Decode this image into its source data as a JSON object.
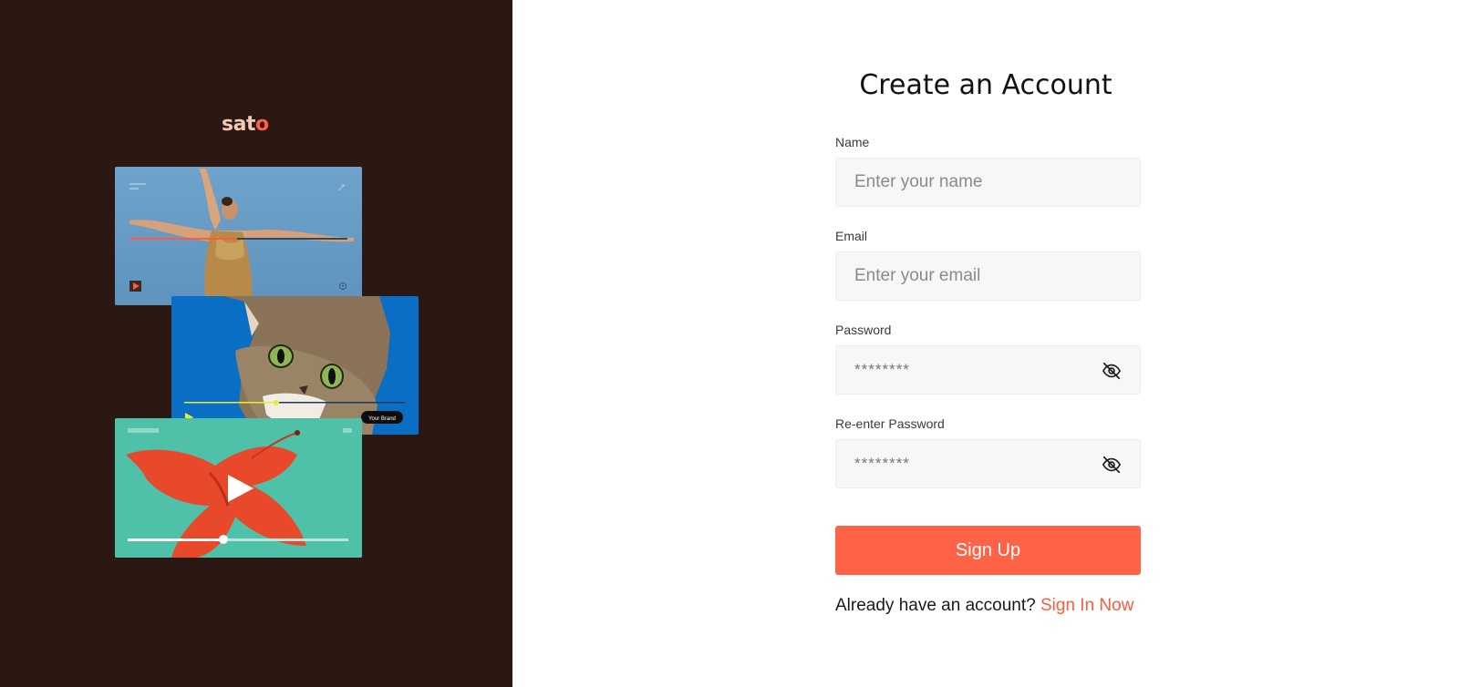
{
  "brand": {
    "logo_main": "sat",
    "logo_accent": "o"
  },
  "cat_card": {
    "badge": "Your Brand"
  },
  "form": {
    "title": "Create an Account",
    "name": {
      "label": "Name",
      "placeholder": "Enter your name"
    },
    "email": {
      "label": "Email",
      "placeholder": "Enter your email"
    },
    "password": {
      "label": "Password",
      "placeholder": "********"
    },
    "confirm_password": {
      "label": "Re-enter Password",
      "placeholder": "********"
    },
    "submit_label": "Sign Up",
    "signin_prompt": "Already have an account?",
    "signin_link": "Sign In Now"
  },
  "colors": {
    "left_panel_bg": "#2b1813",
    "accent": "#ff6347",
    "logo_text": "#f2c9b4",
    "input_bg": "#f7f7f7"
  },
  "icons": {
    "password_toggle": "eye-off-icon",
    "confirm_password_toggle": "eye-off-icon",
    "play": "play-icon"
  }
}
